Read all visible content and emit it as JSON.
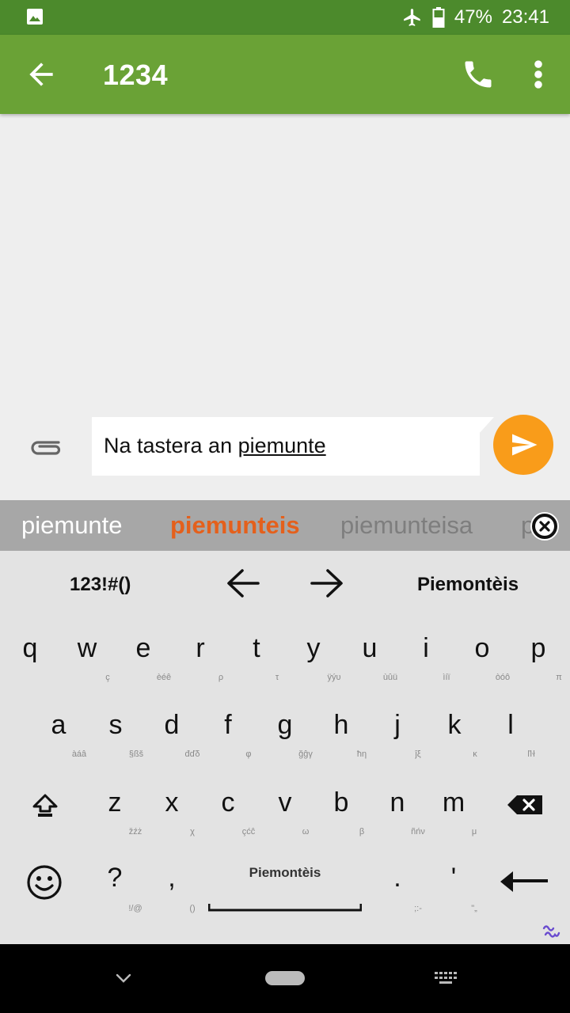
{
  "status_bar": {
    "battery": "47%",
    "time": "23:41",
    "icons": [
      "image-notification-icon",
      "airplane-mode-icon",
      "battery-icon"
    ]
  },
  "app_bar": {
    "title": "1234",
    "icons": [
      "back-arrow-icon",
      "phone-icon",
      "more-vert-icon"
    ]
  },
  "compose": {
    "text_before": "Na tastera an ",
    "text_underlined": "piemunte",
    "icons": [
      "paperclip-icon",
      "send-icon"
    ],
    "accent": "#f99c1a"
  },
  "suggestions": {
    "items": [
      "piemunte",
      "piemunteis",
      "piemunteisa",
      "p"
    ],
    "highlight_color": "#e4601c",
    "close_icon": "close-circle-icon"
  },
  "keyboard": {
    "toolbar": {
      "symbols_label": "123!#()",
      "language_label": "Piemontèis",
      "icons": [
        "left-arrow-icon",
        "right-arrow-icon"
      ]
    },
    "row1": [
      {
        "k": "q",
        "s": ""
      },
      {
        "k": "w",
        "s": "ç"
      },
      {
        "k": "e",
        "s": "èéê"
      },
      {
        "k": "r",
        "s": "ρ"
      },
      {
        "k": "t",
        "s": "τ"
      },
      {
        "k": "y",
        "s": "ÿýυ"
      },
      {
        "k": "u",
        "s": "ùûü"
      },
      {
        "k": "i",
        "s": "ìíï"
      },
      {
        "k": "o",
        "s": "òóô"
      },
      {
        "k": "p",
        "s": "π"
      }
    ],
    "row2": [
      {
        "k": "a",
        "s": "àáâ"
      },
      {
        "k": "s",
        "s": "§ßš"
      },
      {
        "k": "d",
        "s": "đďδ"
      },
      {
        "k": "f",
        "s": "φ"
      },
      {
        "k": "g",
        "s": "ğĝγ"
      },
      {
        "k": "h",
        "s": "ħη"
      },
      {
        "k": "j",
        "s": "ĵξ"
      },
      {
        "k": "k",
        "s": "κ"
      },
      {
        "k": "l",
        "s": "ľŀł"
      }
    ],
    "row3": [
      {
        "k": "z",
        "s": "žźż"
      },
      {
        "k": "x",
        "s": "χ"
      },
      {
        "k": "c",
        "s": "çćĉ"
      },
      {
        "k": "v",
        "s": "ω"
      },
      {
        "k": "b",
        "s": "β"
      },
      {
        "k": "n",
        "s": "ñńν"
      },
      {
        "k": "m",
        "s": "μ"
      }
    ],
    "row4": [
      {
        "k": "?",
        "s": "!/@"
      },
      {
        "k": ",",
        "s": "()"
      },
      {
        "k": ".",
        "s": ";:-"
      },
      {
        "k": "'",
        "s": "\"„"
      }
    ],
    "space_label": "Piemontèis",
    "row_icons": [
      "shift-icon",
      "backspace-icon",
      "emoji-icon",
      "enter-icon",
      "swipe-logo-icon"
    ]
  },
  "nav_bar": {
    "icons": [
      "nav-back-chevron-icon",
      "home-pill-icon",
      "keyboard-switch-icon"
    ]
  }
}
